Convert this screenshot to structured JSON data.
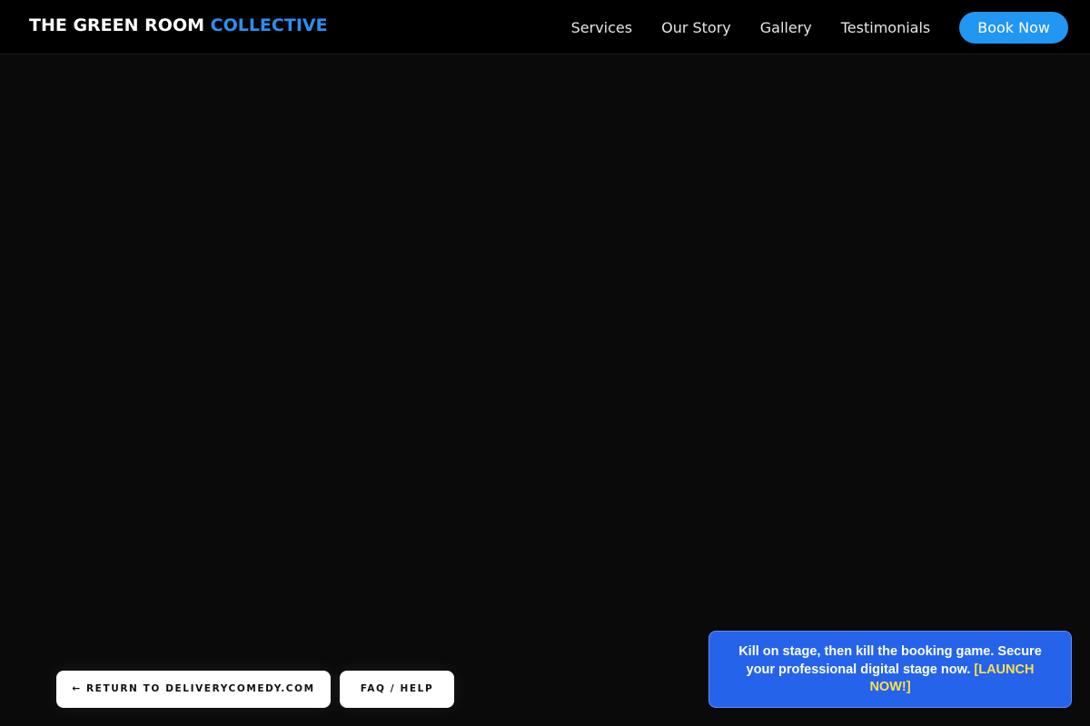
{
  "header": {
    "brand_main": "THE GREEN ROOM ",
    "brand_accent": "COLLECTIVE",
    "nav": [
      "Services",
      "Our Story",
      "Gallery",
      "Testimonials"
    ],
    "book_label": "Book Now"
  },
  "footer_buttons": {
    "return_label": "← RETURN TO DELIVERYCOMEDY.COM",
    "faq_label": "FAQ / HELP"
  },
  "promo": {
    "text": "Kill on stage, then kill the booking game. Secure your professional digital stage now. ",
    "cta": "[LAUNCH NOW!]"
  },
  "colors": {
    "accent": "#2b8ff0",
    "button_blue": "#2196f3",
    "promo_blue": "#2563eb",
    "cta_yellow": "#fde047",
    "background": "#0a0a0a"
  }
}
